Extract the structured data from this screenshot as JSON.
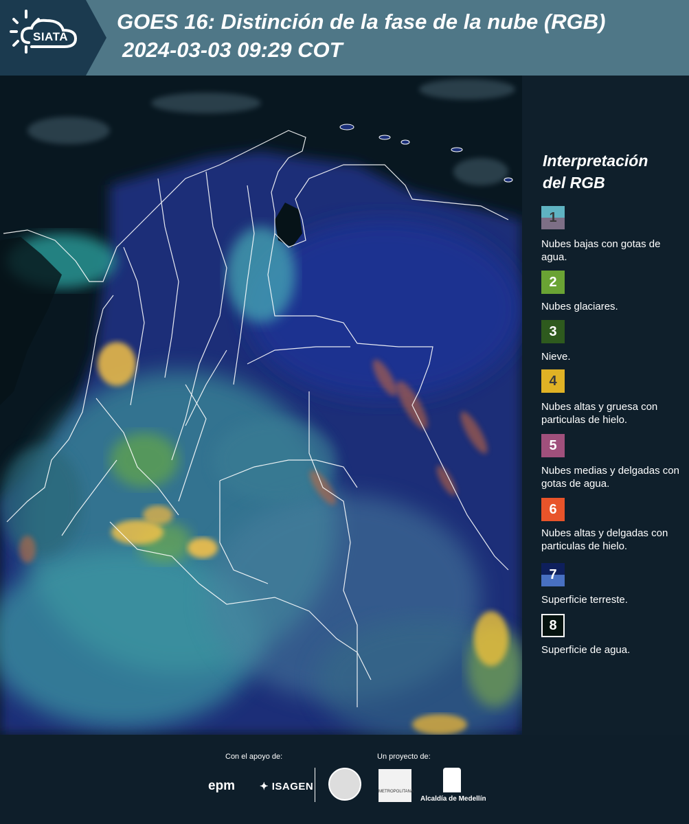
{
  "header": {
    "logo_text": "SIATA",
    "title_line1": "GOES 16: Distinción de la fase de la nube (RGB)",
    "title_line2": "2024-03-03 09:29 COT"
  },
  "legend": {
    "title_line1": "Interpretación",
    "title_line2": "del RGB",
    "items": [
      {
        "num": "1",
        "label": "Nubes bajas con gotas de agua.",
        "color_top": "#5fb3c2",
        "color_bottom": "#7d6f86"
      },
      {
        "num": "2",
        "label": "Nubes glaciares.",
        "color": "#6aa334"
      },
      {
        "num": "3",
        "label": "Nieve.",
        "color": "#2e5a1e"
      },
      {
        "num": "4",
        "label": "Nubes altas y gruesa con particulas de hielo.",
        "color": "#e0b225"
      },
      {
        "num": "5",
        "label": "Nubes medias y delgadas con gotas de agua.",
        "color": "#a0507c"
      },
      {
        "num": "6",
        "label": "Nubes altas y delgadas con particulas de hielo.",
        "color": "#e8542a"
      },
      {
        "num": "7",
        "label": "Superficie terreste.",
        "color_top": "#0e1f5c",
        "color_bottom": "#4870c2"
      },
      {
        "num": "8",
        "label": "Superficie de agua.",
        "color": "#05130f"
      }
    ]
  },
  "footer": {
    "support_label": "Con el apoyo de:",
    "project_label": "Un proyecto de:",
    "epm": "epm",
    "isagen": "ISAGEN",
    "area_metropolitana": "METROPOLITANA",
    "alcaldia": "Alcaldía de Medellín"
  }
}
